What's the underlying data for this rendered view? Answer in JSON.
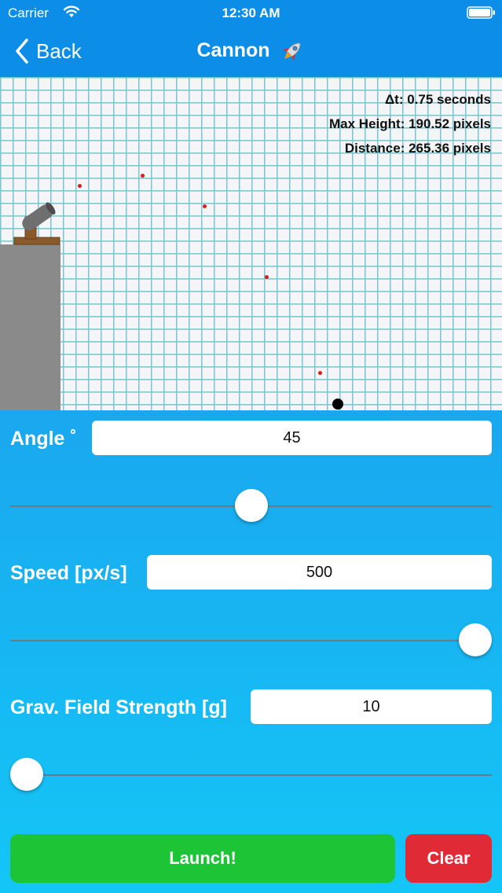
{
  "status": {
    "carrier": "Carrier",
    "time": "12:30 AM"
  },
  "nav": {
    "back_label": "Back",
    "title": "Cannon",
    "title_icon": "rocket-icon"
  },
  "stats": {
    "dt": "Δt: 0.75 seconds",
    "max_height": "Max Height: 190.52 pixels",
    "distance": "Distance: 265.36 pixels"
  },
  "controls": {
    "angle": {
      "label": "Angle ˚",
      "value": "45",
      "slider_fraction": 0.5
    },
    "speed": {
      "label": "Speed [px/s]",
      "value": "500",
      "slider_fraction": 1.0
    },
    "gravity": {
      "label": "Grav. Field Strength [g]",
      "value": "10",
      "slider_fraction": 0.0
    }
  },
  "buttons": {
    "launch": "Launch!",
    "clear": "Clear"
  },
  "colors": {
    "nav_bar": "#0b8de8",
    "trajectory_dot": "#e01b1b",
    "launch_button": "#1dc436",
    "clear_button": "#e02b36",
    "grid_line": "#7ec1d0"
  }
}
